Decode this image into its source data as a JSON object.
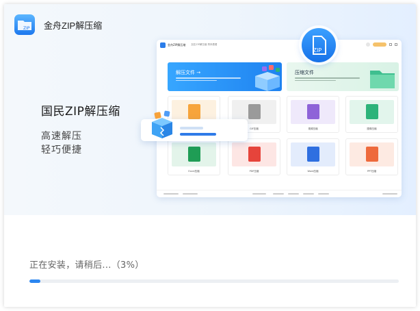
{
  "app": {
    "title": "金舟ZIP解压缩",
    "logo_text": "ZIP",
    "brand_color": "#2b7de9"
  },
  "hero": {
    "product_name": "国民ZIP解压缩",
    "features": [
      "高速解压",
      "轻巧便捷"
    ]
  },
  "preview": {
    "window_title": "金舟ZIP解压缩",
    "menu": "加压ZIP解压缩  再来看看",
    "extract_card": "解压文件 →",
    "compress_card": "压缩文件",
    "tiles": [
      {
        "label": "",
        "color": "#f7a43b",
        "bg": "#fdf1e0"
      },
      {
        "label": "GIF压缩",
        "color": "#9a9a9a",
        "bg": "#f0f0f0"
      },
      {
        "label": "视频压缩",
        "color": "#8e63d8",
        "bg": "#efe9fb"
      },
      {
        "label": "图像压缩",
        "color": "#2db37a",
        "bg": "#e2f5ec"
      },
      {
        "label": "Excel压缩",
        "color": "#1f9d55",
        "bg": "#e3f4ea"
      },
      {
        "label": "PDF压缩",
        "color": "#e6443b",
        "bg": "#fde6e4"
      },
      {
        "label": "Word压缩",
        "color": "#2f6fe0",
        "bg": "#e3ecfc"
      },
      {
        "label": "PPT压缩",
        "color": "#ee6a3c",
        "bg": "#fdeae2"
      }
    ],
    "badge_text": "ZIP"
  },
  "install": {
    "status": "正在安装，请稍后...（3%）",
    "progress": 0.03
  }
}
